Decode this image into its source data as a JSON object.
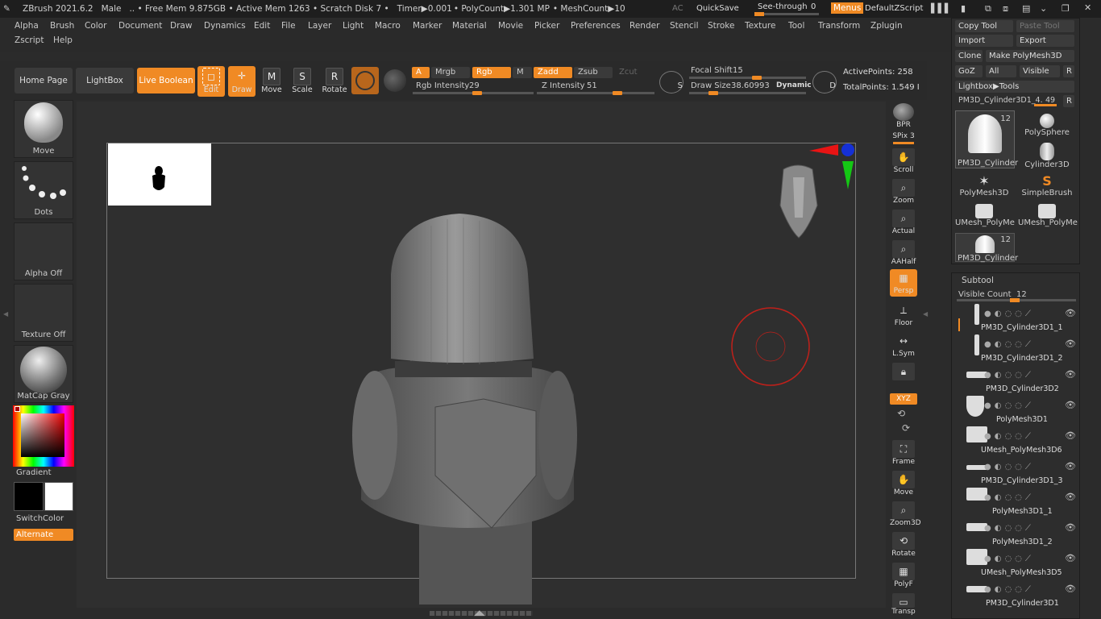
{
  "titlebar": {
    "app": "ZBrush 2021.6.2",
    "project": "Male",
    "mem": ".. • Free Mem 9.875GB • Active Mem 1263 • Scratch Disk 7 •",
    "timer": "Timer▶0.001",
    "polycount": "• PolyCount▶1.301 MP",
    "meshcount": "• MeshCount▶10",
    "ac": "AC",
    "quicksave": "QuickSave",
    "seethrough_label": "See-through",
    "seethrough_value": "0",
    "menus": "Menus",
    "script": "DefaultZScript"
  },
  "menus": [
    "Alpha",
    "Brush",
    "Color",
    "Document",
    "Draw",
    "Dynamics",
    "Edit",
    "File",
    "Layer",
    "Light",
    "Macro",
    "Marker",
    "Material",
    "Movie",
    "Picker",
    "Preferences",
    "Render",
    "Stencil",
    "Stroke",
    "Texture",
    "Tool",
    "Transform",
    "Zplugin"
  ],
  "menus2": [
    "Zscript",
    "Help"
  ],
  "shelf": {
    "home": "Home Page",
    "lightbox": "LightBox",
    "liveboolean": "Live Boolean",
    "edit": "Edit",
    "draw": "Draw",
    "move": "Move",
    "scale": "Scale",
    "rotate": "Rotate",
    "a": "A",
    "mrgb": "Mrgb",
    "rgb": "Rgb",
    "m": "M",
    "zadd": "Zadd",
    "zsub": "Zsub",
    "zcut": "Zcut",
    "rgb_intensity_label": "Rgb Intensity",
    "rgb_intensity": "29",
    "z_intensity_label": "Z Intensity",
    "z_intensity": "51",
    "focal_label": "Focal Shift",
    "focal": "15",
    "drawsize_label": "Draw Size",
    "drawsize": "38.60993",
    "dynamic": "Dynamic",
    "s": "S",
    "d": "D",
    "active_points": "ActivePoints: 258",
    "total_points": "TotalPoints: 1.549 I"
  },
  "left": {
    "brush": "Move",
    "stroke": "Dots",
    "alpha": "Alpha Off",
    "texture": "Texture Off",
    "material": "MatCap Gray",
    "gradient": "Gradient",
    "switchcolor": "SwitchColor",
    "alternate": "Alternate"
  },
  "right_shelf": [
    "BPR",
    "SPix 3",
    "Scroll",
    "Zoom",
    "Actual",
    "AAHalf",
    "Persp",
    "Floor",
    "L.Sym",
    "",
    "XYZ",
    "",
    "",
    "Frame",
    "Move",
    "Zoom3D",
    "Rotate",
    "PolyF",
    "Transp"
  ],
  "toolpanel": {
    "copy": "Copy Tool",
    "paste": "Paste Tool",
    "import": "Import",
    "export": "Export",
    "clone": "Clone",
    "makepm": "Make PolyMesh3D",
    "goz": "GoZ",
    "all": "All",
    "visible": "Visible",
    "r": "R",
    "lightbox_tools": "Lightbox▶Tools",
    "current_tool": "PM3D_Cylinder3D1_4.",
    "current_val": "49",
    "thumbs": [
      {
        "label": "PM3D_Cylinder",
        "count": "12"
      },
      {
        "label": "PolySphere",
        "count": ""
      },
      {
        "label": "Cylinder3D",
        "count": ""
      },
      {
        "label": "PolyMesh3D",
        "count": ""
      },
      {
        "label": "SimpleBrush",
        "count": ""
      },
      {
        "label": "UMesh_PolyMe",
        "count": ""
      },
      {
        "label": "UMesh_PolyMe",
        "count": ""
      },
      {
        "label": "PM3D_Cylinder",
        "count": "12"
      }
    ]
  },
  "subtool": {
    "title": "Subtool",
    "visible_label": "Visible Count",
    "visible_value": "12",
    "items": [
      "PM3D_Cylinder3D1_1",
      "PM3D_Cylinder3D1_2",
      "PM3D_Cylinder3D2",
      "PolyMesh3D1",
      "UMesh_PolyMesh3D6",
      "PM3D_Cylinder3D1_3",
      "PolyMesh3D1_1",
      "PolyMesh3D1_2",
      "UMesh_PolyMesh3D5",
      "PM3D_Cylinder3D1"
    ]
  },
  "colors": {
    "accent": "#f08a24",
    "bg": "#2b2b2b",
    "panel": "#2d2d2d",
    "brush_ring": "#c0201a"
  }
}
